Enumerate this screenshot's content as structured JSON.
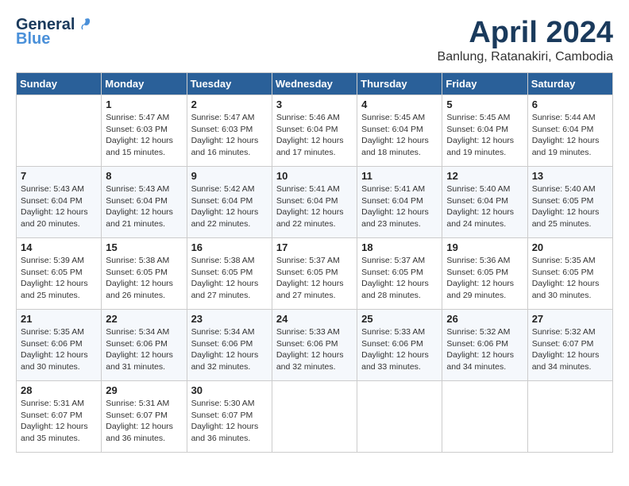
{
  "header": {
    "logo_line1": "General",
    "logo_line2": "Blue",
    "month_title": "April 2024",
    "location": "Banlung, Ratanakiri, Cambodia"
  },
  "days_of_week": [
    "Sunday",
    "Monday",
    "Tuesday",
    "Wednesday",
    "Thursday",
    "Friday",
    "Saturday"
  ],
  "weeks": [
    [
      {
        "day": "",
        "info": ""
      },
      {
        "day": "1",
        "info": "Sunrise: 5:47 AM\nSunset: 6:03 PM\nDaylight: 12 hours\nand 15 minutes."
      },
      {
        "day": "2",
        "info": "Sunrise: 5:47 AM\nSunset: 6:03 PM\nDaylight: 12 hours\nand 16 minutes."
      },
      {
        "day": "3",
        "info": "Sunrise: 5:46 AM\nSunset: 6:04 PM\nDaylight: 12 hours\nand 17 minutes."
      },
      {
        "day": "4",
        "info": "Sunrise: 5:45 AM\nSunset: 6:04 PM\nDaylight: 12 hours\nand 18 minutes."
      },
      {
        "day": "5",
        "info": "Sunrise: 5:45 AM\nSunset: 6:04 PM\nDaylight: 12 hours\nand 19 minutes."
      },
      {
        "day": "6",
        "info": "Sunrise: 5:44 AM\nSunset: 6:04 PM\nDaylight: 12 hours\nand 19 minutes."
      }
    ],
    [
      {
        "day": "7",
        "info": "Sunrise: 5:43 AM\nSunset: 6:04 PM\nDaylight: 12 hours\nand 20 minutes."
      },
      {
        "day": "8",
        "info": "Sunrise: 5:43 AM\nSunset: 6:04 PM\nDaylight: 12 hours\nand 21 minutes."
      },
      {
        "day": "9",
        "info": "Sunrise: 5:42 AM\nSunset: 6:04 PM\nDaylight: 12 hours\nand 22 minutes."
      },
      {
        "day": "10",
        "info": "Sunrise: 5:41 AM\nSunset: 6:04 PM\nDaylight: 12 hours\nand 22 minutes."
      },
      {
        "day": "11",
        "info": "Sunrise: 5:41 AM\nSunset: 6:04 PM\nDaylight: 12 hours\nand 23 minutes."
      },
      {
        "day": "12",
        "info": "Sunrise: 5:40 AM\nSunset: 6:04 PM\nDaylight: 12 hours\nand 24 minutes."
      },
      {
        "day": "13",
        "info": "Sunrise: 5:40 AM\nSunset: 6:05 PM\nDaylight: 12 hours\nand 25 minutes."
      }
    ],
    [
      {
        "day": "14",
        "info": "Sunrise: 5:39 AM\nSunset: 6:05 PM\nDaylight: 12 hours\nand 25 minutes."
      },
      {
        "day": "15",
        "info": "Sunrise: 5:38 AM\nSunset: 6:05 PM\nDaylight: 12 hours\nand 26 minutes."
      },
      {
        "day": "16",
        "info": "Sunrise: 5:38 AM\nSunset: 6:05 PM\nDaylight: 12 hours\nand 27 minutes."
      },
      {
        "day": "17",
        "info": "Sunrise: 5:37 AM\nSunset: 6:05 PM\nDaylight: 12 hours\nand 27 minutes."
      },
      {
        "day": "18",
        "info": "Sunrise: 5:37 AM\nSunset: 6:05 PM\nDaylight: 12 hours\nand 28 minutes."
      },
      {
        "day": "19",
        "info": "Sunrise: 5:36 AM\nSunset: 6:05 PM\nDaylight: 12 hours\nand 29 minutes."
      },
      {
        "day": "20",
        "info": "Sunrise: 5:35 AM\nSunset: 6:05 PM\nDaylight: 12 hours\nand 30 minutes."
      }
    ],
    [
      {
        "day": "21",
        "info": "Sunrise: 5:35 AM\nSunset: 6:06 PM\nDaylight: 12 hours\nand 30 minutes."
      },
      {
        "day": "22",
        "info": "Sunrise: 5:34 AM\nSunset: 6:06 PM\nDaylight: 12 hours\nand 31 minutes."
      },
      {
        "day": "23",
        "info": "Sunrise: 5:34 AM\nSunset: 6:06 PM\nDaylight: 12 hours\nand 32 minutes."
      },
      {
        "day": "24",
        "info": "Sunrise: 5:33 AM\nSunset: 6:06 PM\nDaylight: 12 hours\nand 32 minutes."
      },
      {
        "day": "25",
        "info": "Sunrise: 5:33 AM\nSunset: 6:06 PM\nDaylight: 12 hours\nand 33 minutes."
      },
      {
        "day": "26",
        "info": "Sunrise: 5:32 AM\nSunset: 6:06 PM\nDaylight: 12 hours\nand 34 minutes."
      },
      {
        "day": "27",
        "info": "Sunrise: 5:32 AM\nSunset: 6:07 PM\nDaylight: 12 hours\nand 34 minutes."
      }
    ],
    [
      {
        "day": "28",
        "info": "Sunrise: 5:31 AM\nSunset: 6:07 PM\nDaylight: 12 hours\nand 35 minutes."
      },
      {
        "day": "29",
        "info": "Sunrise: 5:31 AM\nSunset: 6:07 PM\nDaylight: 12 hours\nand 36 minutes."
      },
      {
        "day": "30",
        "info": "Sunrise: 5:30 AM\nSunset: 6:07 PM\nDaylight: 12 hours\nand 36 minutes."
      },
      {
        "day": "",
        "info": ""
      },
      {
        "day": "",
        "info": ""
      },
      {
        "day": "",
        "info": ""
      },
      {
        "day": "",
        "info": ""
      }
    ]
  ]
}
